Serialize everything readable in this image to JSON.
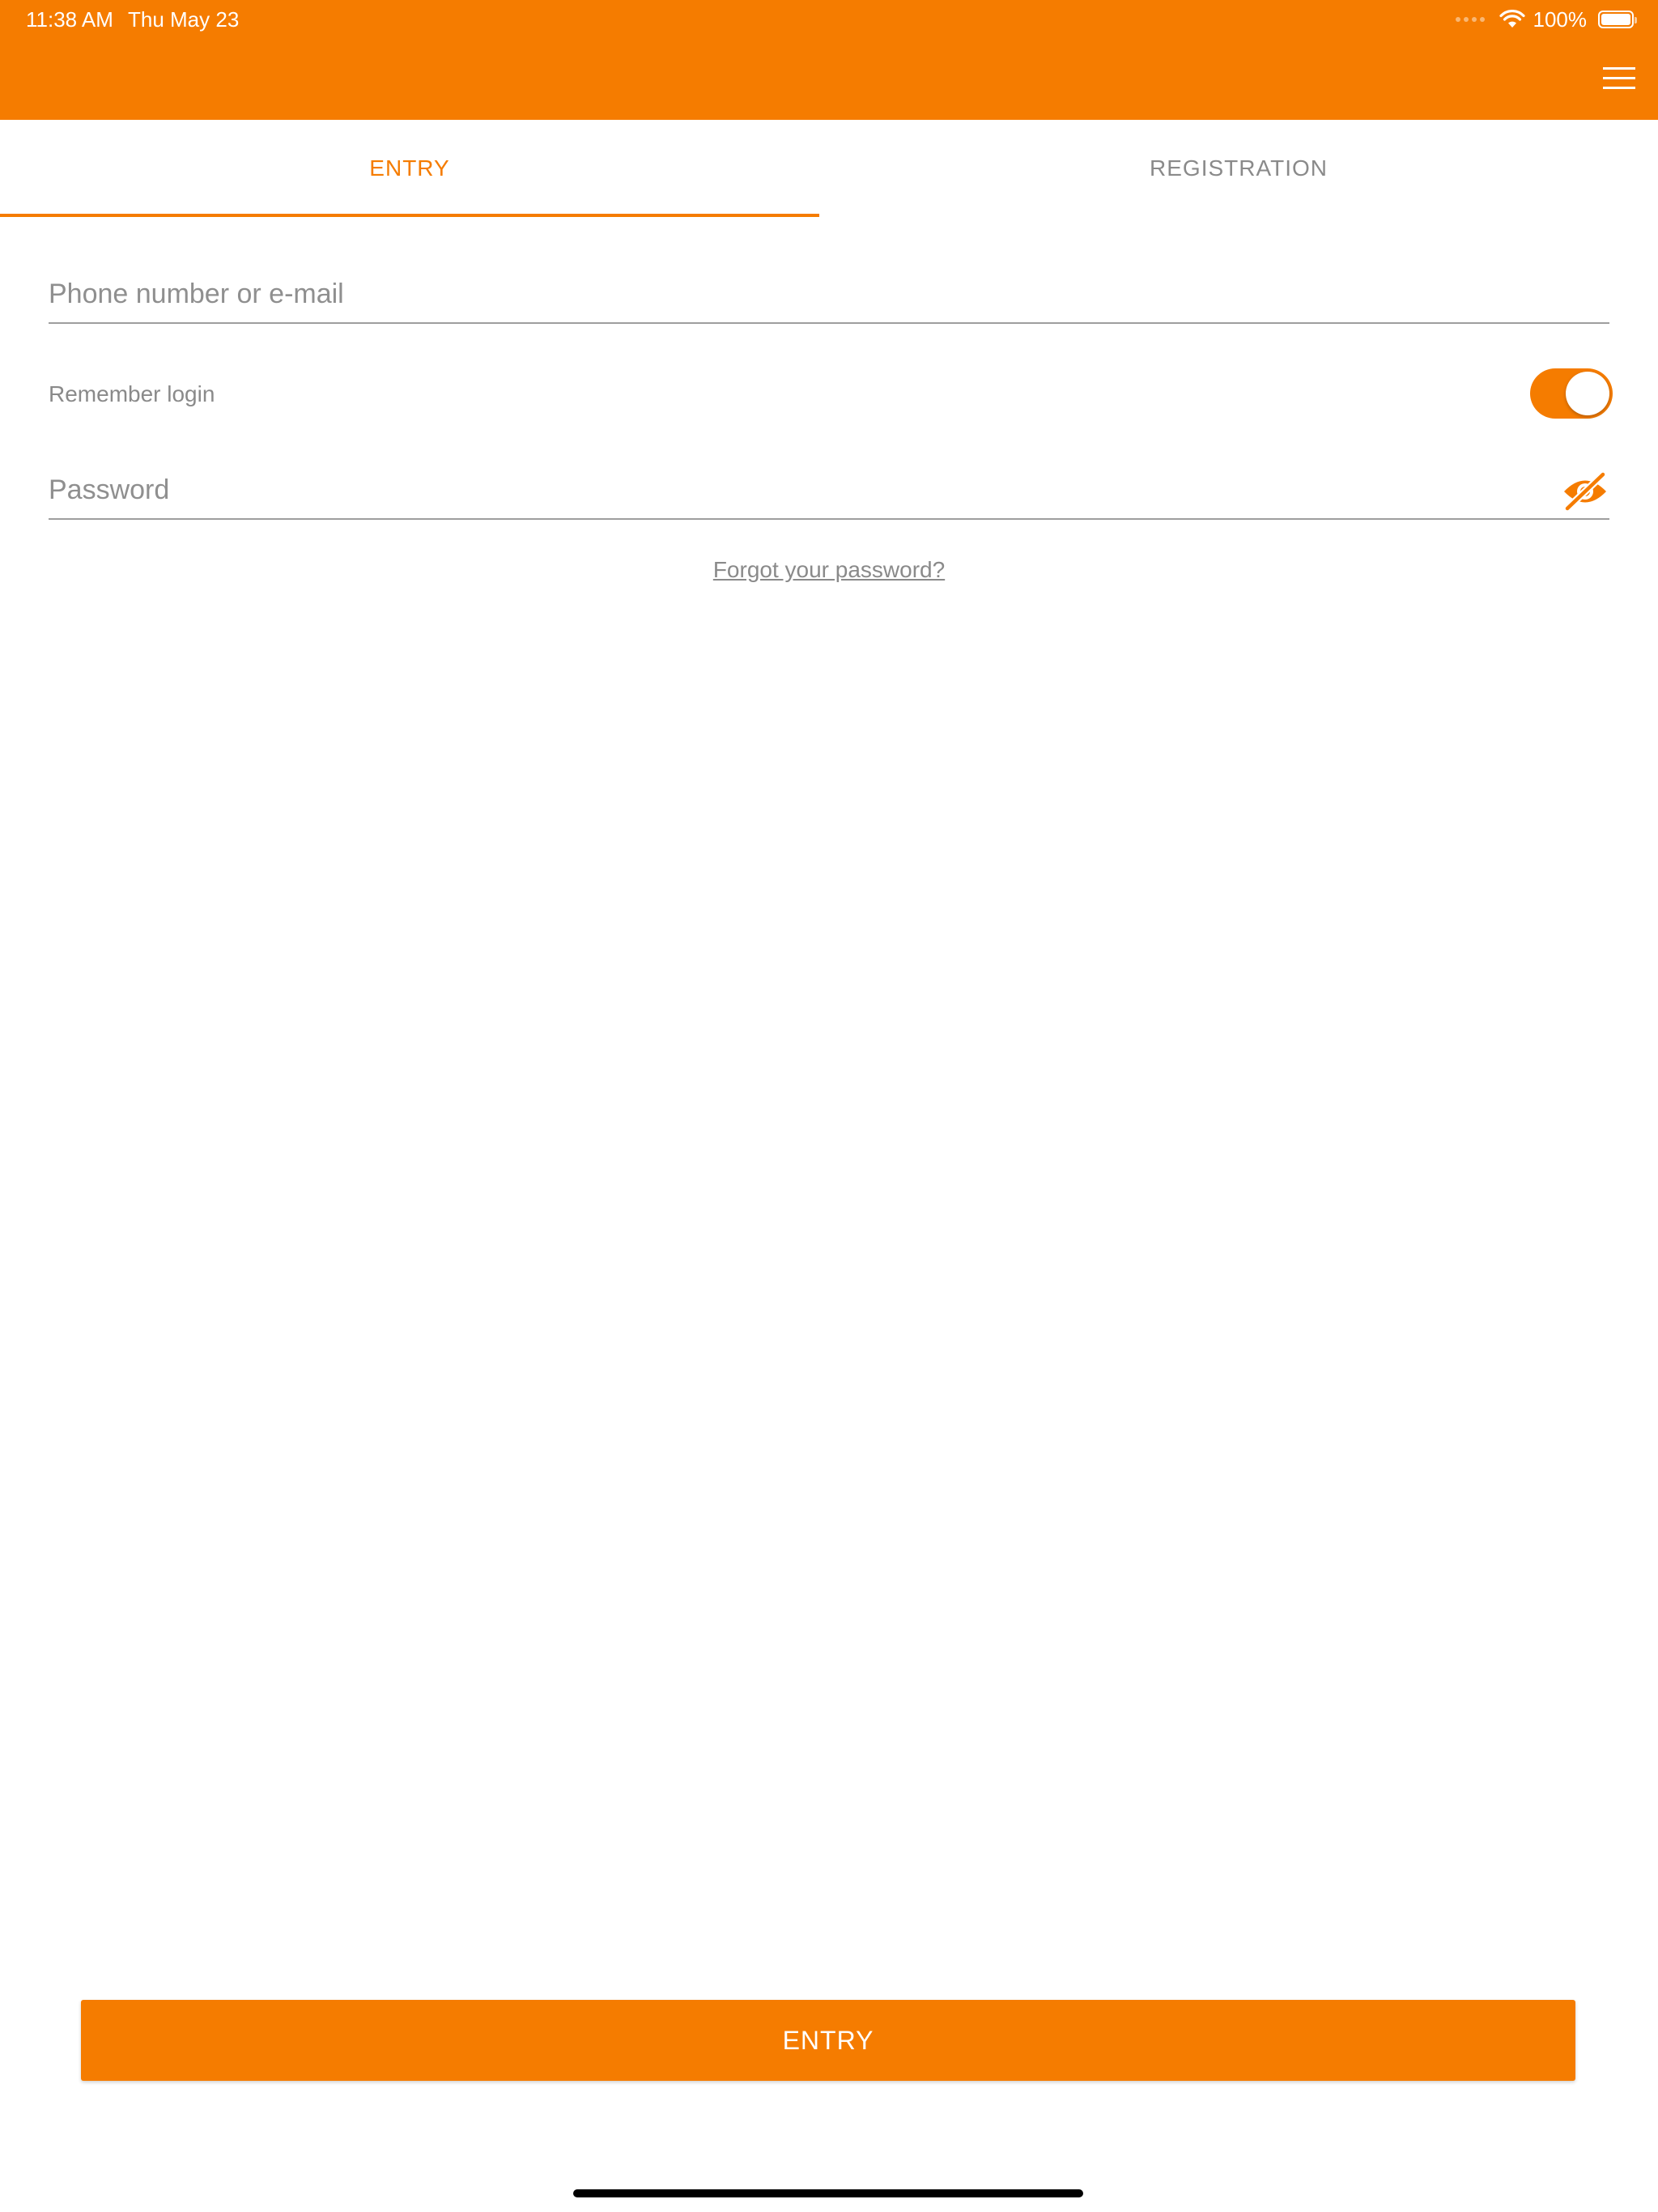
{
  "status_bar": {
    "time": "11:38 AM",
    "date": "Thu May 23",
    "battery": "100%",
    "battery_level": 1.0
  },
  "header": {
    "menu_icon": "hamburger-menu-icon"
  },
  "tabs": [
    {
      "label": "ENTRY",
      "active": true
    },
    {
      "label": "REGISTRATION",
      "active": false
    }
  ],
  "form": {
    "login_placeholder": "Phone number or e-mail",
    "login_value": "",
    "remember_label": "Remember login",
    "remember_on": true,
    "password_placeholder": "Password",
    "password_value": "",
    "password_icon": "eye-slash-icon",
    "forgot_link": "Forgot your password?"
  },
  "submit": {
    "label": "ENTRY"
  },
  "colors": {
    "accent": "#F57C00",
    "muted_text": "#8a8a8a",
    "underline": "#9e9e9e"
  }
}
